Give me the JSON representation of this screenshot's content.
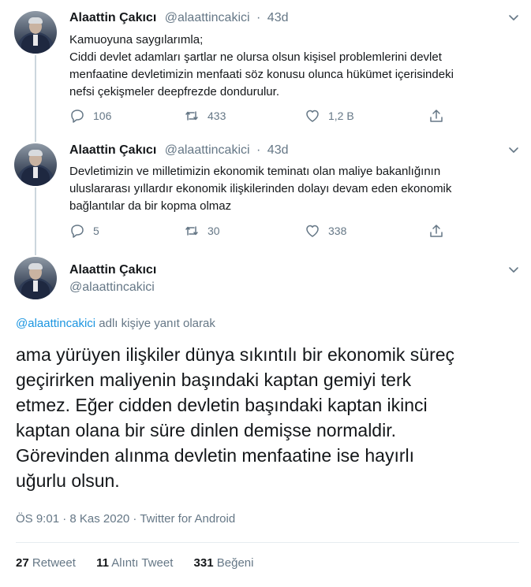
{
  "tweets": [
    {
      "name": "Alaattin Çakıcı",
      "handle": "@alaattincakici",
      "sep": "·",
      "time": "43d",
      "lines": [
        "Kamuoyuna saygılarımla;",
        "Ciddi devlet adamları şartlar ne olursa olsun kişisel problemlerini devlet",
        "menfaatine devletimizin menfaati söz konusu olunca hükümet içerisindeki",
        "nefsi çekişmeler deepfrezde dondurulur."
      ],
      "replies": "106",
      "retweets": "433",
      "likes": "1,2 B"
    },
    {
      "name": "Alaattin Çakıcı",
      "handle": "@alaattincakici",
      "sep": "·",
      "time": "43d",
      "lines": [
        "Devletimizin ve milletimizin ekonomik teminatı olan maliye bakanlığının",
        "uluslararası yıllardır ekonomik ilişkilerinden dolayı devam eden ekonomik",
        "bağlantılar da bir kopma olmaz"
      ],
      "replies": "5",
      "retweets": "30",
      "likes": "338"
    }
  ],
  "main": {
    "name": "Alaattin Çakıcı",
    "handle": "@alaattincakici",
    "reply_link": "@alaattincakici",
    "reply_suffix": " adlı kişiye yanıt olarak",
    "lines": [
      "ama yürüyen ilişkiler dünya sıkıntılı bir ekonomik süreç",
      "geçirirken maliyenin başındaki kaptan gemiyi terk",
      "etmez. Eğer cidden devletin başındaki kaptan ikinci",
      "kaptan olana bir süre dinlen demişse normaldir.",
      "Görevinden alınma devletin menfaatine ise hayırlı",
      "uğurlu olsun."
    ],
    "meta": "ÖS 9:01 · 8 Kas 2020 · Twitter for Android",
    "retweets_num": "27",
    "retweets_label": "Retweet",
    "quotes_num": "11",
    "quotes_label": "Alıntı Tweet",
    "likes_num": "331",
    "likes_label": "Beğeni"
  },
  "colors": {
    "link": "#1b95e0",
    "muted": "#657786",
    "text": "#14171a",
    "thread_line": "#ccd6dd"
  },
  "icons": [
    "reply-icon",
    "retweet-icon",
    "like-icon",
    "share-icon",
    "caret-down-icon"
  ]
}
